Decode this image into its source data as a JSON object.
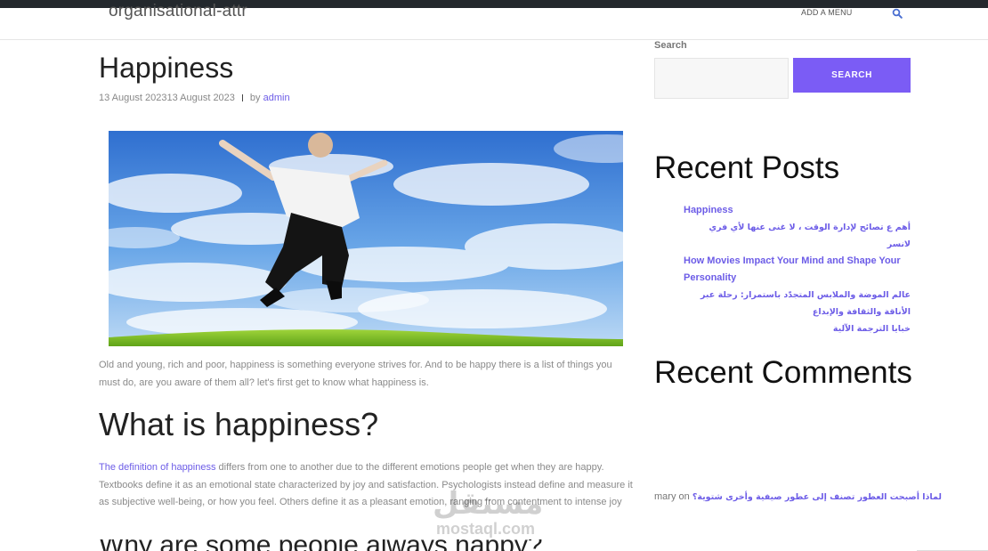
{
  "header": {
    "site_title": "organisational-attr",
    "menu_label": "ADD A MENU",
    "search_icon": "search-icon"
  },
  "post": {
    "title": "Happiness",
    "date_text": "13 August 202313 August 2023",
    "by_label": "by",
    "author": "admin",
    "intro": "Old and young, rich and poor, happiness is something everyone strives for. And to be happy there is a list of things you must do, are you aware of them all? let's first get to know what happiness is.",
    "h2": "What is happiness?",
    "para_link": "The definition of happiness",
    "para_rest": " differs from one to another due to the different emotions people get when they are happy. Textbooks define it as an emotional state characterized by joy and satisfaction. Psychologists instead define and measure it as subjective well-being, or how you feel. Others define it as a pleasant emotion, ranging from contentment to intense joy",
    "h3_partial": "Why are some people always happy?"
  },
  "watermark": {
    "arabic": "مستقل",
    "latin": "mostaql.com"
  },
  "sidebar": {
    "search_label": "Search",
    "search_placeholder": "",
    "search_button": "SEARCH",
    "recent_posts_title": "Recent Posts",
    "recent_posts": [
      "Happiness",
      "أهم ع تصائح لإدارة الوقت ، لا غنى عنها لأي فري لانسر",
      "How Movies Impact Your Mind and Shape Your Personality",
      "عالم الموضة والملابس المتجدّد باستمرار: رحلة عبر الأناقة والثقافة والإبداع",
      "خبايا الترجمة الآلية"
    ],
    "recent_comments_title": "Recent Comments",
    "comment_author": "mary",
    "comment_on": "on",
    "comment_article": "لماذا أصبحت العطور تصنف إلى عطور صيفية وأخرى شتوية؟"
  },
  "colors": {
    "accent": "#7b5cf5",
    "link": "#6c5ce7",
    "topbar": "#23282d"
  }
}
